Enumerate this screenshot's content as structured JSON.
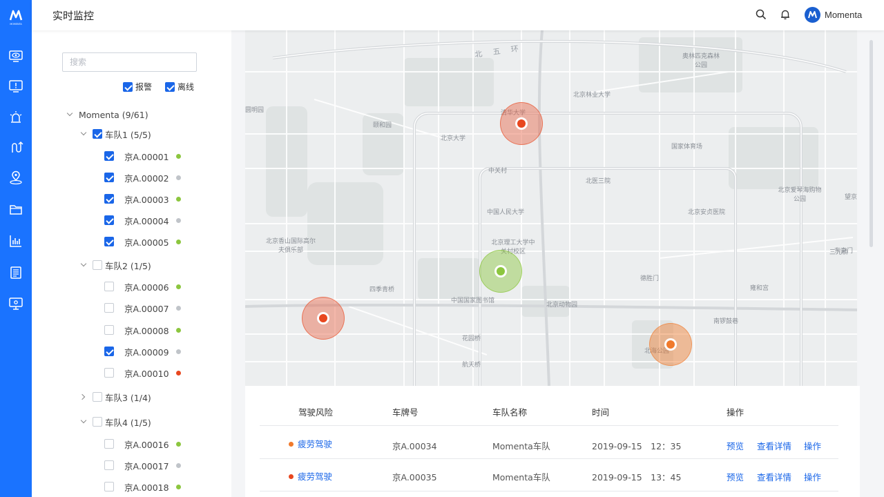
{
  "app": {
    "title": "实时监控",
    "username": "Momenta",
    "logo_text": "MOMENTA"
  },
  "rail": {
    "icons": [
      "monitor-eye-icon",
      "screen-alert-icon",
      "alarm-light-icon",
      "route-icon",
      "location-pin-icon",
      "folder-icon",
      "bar-chart-icon",
      "report-list-icon",
      "display-settings-icon"
    ]
  },
  "header": {
    "icons": [
      "search-icon",
      "bell-icon"
    ]
  },
  "tree": {
    "search_placeholder": "搜索",
    "filters": [
      {
        "label": "报警",
        "checked": true
      },
      {
        "label": "离线",
        "checked": true
      }
    ],
    "root_label": "Momenta (9/61)",
    "groups": [
      {
        "label": "车队1 (5/5)",
        "expanded": true,
        "checked": true,
        "vehicles": [
          {
            "plate": "京A.00001",
            "checked": true,
            "status": "#8cc63f"
          },
          {
            "plate": "京A.00002",
            "checked": true,
            "status": "#c0c4c9"
          },
          {
            "plate": "京A.00003",
            "checked": true,
            "status": "#8cc63f"
          },
          {
            "plate": "京A.00004",
            "checked": true,
            "status": "#c0c4c9"
          },
          {
            "plate": "京A.00005",
            "checked": true,
            "status": "#8cc63f"
          }
        ]
      },
      {
        "label": "车队2 (1/5)",
        "expanded": true,
        "checked": false,
        "vehicles": [
          {
            "plate": "京A.00006",
            "checked": false,
            "status": "#8cc63f"
          },
          {
            "plate": "京A.00007",
            "checked": false,
            "status": "#c0c4c9"
          },
          {
            "plate": "京A.00008",
            "checked": false,
            "status": "#8cc63f"
          },
          {
            "plate": "京A.00009",
            "checked": true,
            "status": "#c0c4c9"
          },
          {
            "plate": "京A.00010",
            "checked": false,
            "status": "#e8471f"
          }
        ]
      },
      {
        "label": "车队3 (1/4)",
        "expanded": false,
        "checked": false,
        "vehicles": []
      },
      {
        "label": "车队4 (1/5)",
        "expanded": true,
        "checked": false,
        "vehicles": [
          {
            "plate": "京A.00016",
            "checked": false,
            "status": "#8cc63f"
          },
          {
            "plate": "京A.00017",
            "checked": false,
            "status": "#c0c4c9"
          },
          {
            "plate": "京A.00018",
            "checked": false,
            "status": "#8cc63f"
          }
        ]
      }
    ]
  },
  "map": {
    "ring_road_label": "北 五 环",
    "labels": [
      "奥林匹克森林公园",
      "北京林业大学",
      "圆明园",
      "颐和园",
      "清华大学",
      "北京大学",
      "中关村",
      "北医三院",
      "国家体育场",
      "北京爱琴海购物公园",
      "中国人民大学",
      "北京安贞医院",
      "北京香山国际高尔夫俱乐部",
      "北京理工大学中关村校区",
      "四季青桥",
      "中国国家图书馆",
      "北京动物园",
      "德胜门",
      "雍和宫",
      "东直门",
      "花园桥",
      "航天桥",
      "北海公园",
      "南锣鼓巷",
      "三元桥",
      "望京"
    ],
    "markers": [
      {
        "name": "marker-red-north",
        "color": "#e8471f"
      },
      {
        "name": "marker-green-center",
        "color": "#8cc63f"
      },
      {
        "name": "marker-red-west",
        "color": "#e8471f"
      },
      {
        "name": "marker-orange-east",
        "color": "#f07a2c"
      }
    ]
  },
  "table": {
    "headers": [
      "驾驶风险",
      "车牌号",
      "车队名称",
      "时间",
      "操作"
    ],
    "rows": [
      {
        "risk": "疲劳驾驶",
        "risk_color": "#f07a2c",
        "plate": "京A.00034",
        "team": "Momenta车队",
        "time": "2019-09-15　12：35",
        "actions": [
          "预览",
          "查看详情",
          "操作"
        ]
      },
      {
        "risk": "疲劳驾驶",
        "risk_color": "#e8471f",
        "plate": "京A.00035",
        "team": "Momenta车队",
        "time": "2019-09-15　13：45",
        "actions": [
          "预览",
          "查看详情",
          "操作"
        ]
      }
    ]
  },
  "colors": {
    "accent": "#1a66e8",
    "rail": "#1a73ff"
  }
}
